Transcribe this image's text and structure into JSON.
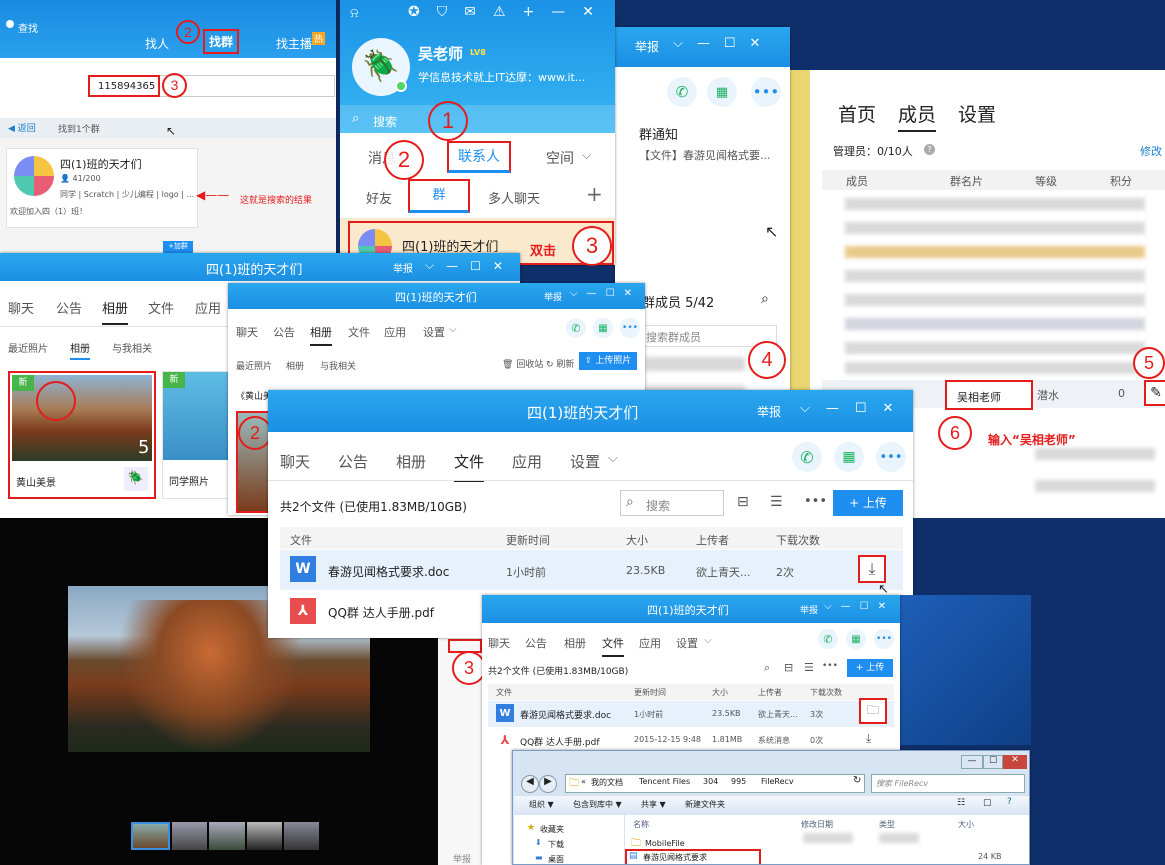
{
  "search_window": {
    "title": "查找",
    "tabs": [
      "找人",
      "找群",
      "找主播"
    ],
    "live_badge": "热",
    "query": "115894365",
    "back": "返回",
    "found": "找到1个群",
    "group": {
      "name": "四(1)班的天才们",
      "members": "41/200",
      "tags": "同学 | Scratch | 少儿编程 | logo | ...",
      "desc": "欢迎加入四（1）班！"
    },
    "annotation": "这就是搜索的结果",
    "add_button": "+加群"
  },
  "qq_main": {
    "username": "吴老师",
    "level": "LV8",
    "signature": "学信息技术就上IT达摩：www.it...",
    "search": "搜索",
    "tabs": [
      "消息",
      "联系人",
      "空间"
    ],
    "subtabs": [
      "好友",
      "群",
      "多人聊天"
    ],
    "plus": "+",
    "group_item": "四(1)班的天才们",
    "dblclick": "双击"
  },
  "group_chat": {
    "report": "举报",
    "notice_title": "群通知",
    "notice_text": "【文件】春游见闻格式要...",
    "members_title": "群成员 5/42",
    "member_search": "搜索群成员"
  },
  "members_page": {
    "tabs": [
      "首页",
      "成员",
      "设置"
    ],
    "admins": "管理员：0/10人",
    "modify": "修改",
    "columns": [
      "成员",
      "群名片",
      "等级",
      "积分"
    ],
    "input_value": "吴相老师",
    "level_value": "潜水",
    "points_value": "0",
    "annotation": "输入“吴相老师”"
  },
  "album_window": {
    "title": "四(1)班的天才们",
    "report": "举报",
    "tabs": [
      "聊天",
      "公告",
      "相册",
      "文件",
      "应用"
    ],
    "subtabs": [
      "最近照片",
      "相册",
      "与我相关"
    ],
    "album1": {
      "name": "黄山美景",
      "count": "5",
      "badge": "新"
    },
    "album2": {
      "name": "同学照片",
      "badge": "新"
    }
  },
  "album_window2": {
    "title": "四(1)班的天才们",
    "report": "举报",
    "tabs": [
      "聊天",
      "公告",
      "相册",
      "文件",
      "应用",
      "设置"
    ],
    "subtabs": [
      "最近照片",
      "相册",
      "与我相关"
    ],
    "actions": [
      "回收站",
      "刷新"
    ],
    "upload": "上传照片",
    "album_label": "《黄山美"
  },
  "files_window": {
    "title": "四(1)班的天才们",
    "report": "举报",
    "tabs": [
      "聊天",
      "公告",
      "相册",
      "文件",
      "应用",
      "设置"
    ],
    "summary": "共2个文件 (已使用1.83MB/10GB)",
    "search": "搜索",
    "upload": "+ 上传",
    "columns": [
      "文件",
      "更新时间",
      "大小",
      "上传者",
      "下载次数"
    ],
    "rows": [
      {
        "name": "春游见闻格式要求.doc",
        "time": "1小时前",
        "size": "23.5KB",
        "uploader": "欲上青天...",
        "downloads": "2次"
      },
      {
        "name": "QQ群 达人手册.pdf",
        "time": "",
        "size": "",
        "uploader": "",
        "downloads": ""
      }
    ]
  },
  "files_window2": {
    "title": "四(1)班的天才们",
    "report": "举报",
    "tabs": [
      "聊天",
      "公告",
      "相册",
      "文件",
      "应用",
      "设置"
    ],
    "summary": "共2个文件 (已使用1.83MB/10GB)",
    "upload": "+ 上传",
    "columns": [
      "文件",
      "更新时间",
      "大小",
      "上传者",
      "下载次数"
    ],
    "rows": [
      {
        "name": "春游见闻格式要求.doc",
        "time": "1小时前",
        "size": "23.5KB",
        "uploader": "欲上青天...",
        "downloads": "3次"
      },
      {
        "name": "QQ群 达人手册.pdf",
        "time": "2015-12-15 9:48",
        "size": "1.81MB",
        "uploader": "系统消息",
        "downloads": "0次"
      }
    ]
  },
  "explorer": {
    "path": [
      "«",
      "我的文档",
      "Tencent Files",
      "304",
      "995",
      "FileRecv"
    ],
    "search": "搜索 FileRecv",
    "menu": [
      "组织 ▼",
      "包含到库中 ▼",
      "共享 ▼",
      "新建文件夹"
    ],
    "sidebar": [
      "收藏夹",
      "下载",
      "桌面"
    ],
    "columns": [
      "名称",
      "修改日期",
      "类型",
      "大小"
    ],
    "files": [
      {
        "name": "MobileFile",
        "size": ""
      },
      {
        "name": "春游见闻格式要求",
        "size": "24 KB"
      }
    ]
  },
  "viewer": {
    "report": "举报"
  },
  "markers": [
    "1",
    "2",
    "3",
    "4",
    "5",
    "6"
  ],
  "colors": {
    "accent": "#1f8ef1",
    "annot": "#e51c1c"
  }
}
